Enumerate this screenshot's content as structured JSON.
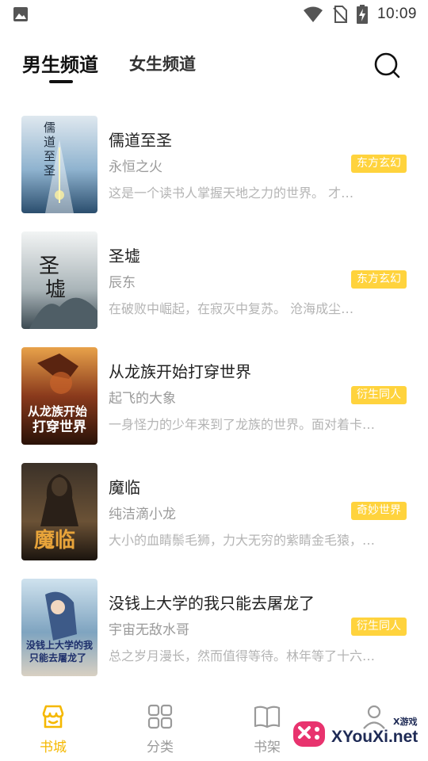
{
  "status_bar": {
    "time": "10:09",
    "icons": [
      "image-icon",
      "wifi-icon",
      "no-sim-icon",
      "battery-charging-icon"
    ]
  },
  "header": {
    "tabs": [
      {
        "label": "男生频道",
        "active": true
      },
      {
        "label": "女生频道",
        "active": false
      }
    ],
    "search_icon": "search-icon"
  },
  "books": [
    {
      "title": "儒道至圣",
      "author": "永恒之火",
      "tag": "东方玄幻",
      "description": "这是一个读书人掌握天地之力的世界。        才…",
      "cover_text": "儒道至圣"
    },
    {
      "title": "圣墟",
      "author": "辰东",
      "tag": "东方玄幻",
      "description": "在破败中崛起，在寂灭中复苏。        沧海成尘…",
      "cover_text": "圣墟"
    },
    {
      "title": "从龙族开始打穿世界",
      "author": "起飞的大象",
      "tag": "衍生同人",
      "description": "一身怪力的少年来到了龙族的世界。面对着卡…",
      "cover_text": "从龙族开始打穿世界"
    },
    {
      "title": "魔临",
      "author": "纯洁滴小龙",
      "tag": "奇妙世界",
      "description": "大小的血睛鬃毛狮，力大无穷的紫睛金毛猿，…",
      "cover_text": "魔临"
    },
    {
      "title": "没钱上大学的我只能去屠龙了",
      "author": "宇宙无敌水哥",
      "tag": "衍生同人",
      "description": "总之岁月漫长，然而值得等待。林年等了十六…",
      "cover_text": "没钱上大学的我只能去屠龙了"
    }
  ],
  "bottom_nav": [
    {
      "label": "书城",
      "icon": "store-icon",
      "active": true
    },
    {
      "label": "分类",
      "icon": "grid-icon",
      "active": false
    },
    {
      "label": "书架",
      "icon": "book-open-icon",
      "active": false
    },
    {
      "label": "",
      "icon": "profile-icon",
      "active": false
    }
  ],
  "watermark": {
    "text": "XYouXi.net",
    "small_text": "X游戏"
  },
  "colors": {
    "accent": "#ffd33d",
    "active_nav": "#f5b800",
    "muted_text": "#9a9a9a",
    "description_text": "#b4b4b4"
  }
}
